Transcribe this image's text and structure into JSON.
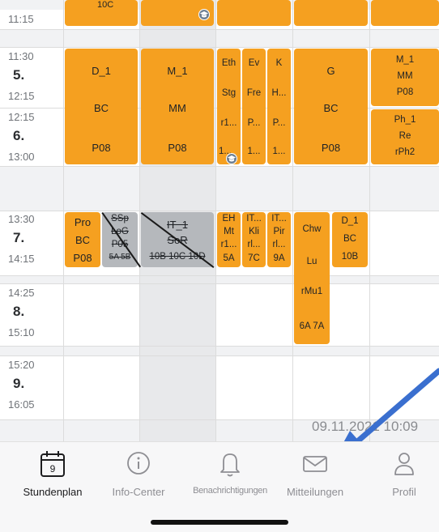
{
  "times": [
    {
      "id": "p4",
      "start": "11:15",
      "end": "",
      "num": ""
    },
    {
      "id": "p5",
      "start": "11:30",
      "end": "12:15",
      "num": "5."
    },
    {
      "id": "p6",
      "start": "12:15",
      "end": "13:00",
      "num": "6."
    },
    {
      "id": "p7",
      "start": "13:30",
      "end": "14:15",
      "num": "7."
    },
    {
      "id": "p8",
      "start": "14:25",
      "end": "15:10",
      "num": "8."
    },
    {
      "id": "p9",
      "start": "15:20",
      "end": "16:05",
      "num": "9."
    }
  ],
  "lessons": {
    "mon56": {
      "l1": "D_1",
      "l2": "BC",
      "l3": "P08"
    },
    "tue56": {
      "l1": "M_1",
      "l2": "MM",
      "l3": "P08"
    },
    "wed56a": {
      "l1": "Eth",
      "l2": "Stg",
      "l3": "r1...",
      "l4": "1..."
    },
    "wed56b": {
      "l1": "Ev",
      "l2": "Fre",
      "l3": "P...",
      "l4": "1..."
    },
    "wed56c": {
      "l1": "K",
      "l2": "H...",
      "l3": "P...",
      "l4": "1..."
    },
    "thu56": {
      "l1": "G",
      "l2": "BC",
      "l3": "P08"
    },
    "fri5": {
      "l1": "M_1",
      "l2": "MM",
      "l3": "P08"
    },
    "fri6": {
      "l1": "Ph_1",
      "l2": "Re",
      "l3": "rPh2"
    },
    "mon7a": {
      "l1": "Pro",
      "l2": "BC",
      "l3": "P08"
    },
    "mon7b": {
      "l1": "SSp",
      "l2": "LoG",
      "l3": "P05",
      "l4": "5A 5B"
    },
    "tue7": {
      "l1": "IT_1",
      "l2": "SoR",
      "l3": "10B 10C 10D"
    },
    "wed7a": {
      "l1": "EH",
      "l2": "Mt",
      "l3": "r1...",
      "l4": "5A"
    },
    "wed7b": {
      "l1": "IT...",
      "l2": "Kli",
      "l3": "rl...",
      "l4": "7C"
    },
    "wed7c": {
      "l1": "IT...",
      "l2": "Pir",
      "l3": "rl...",
      "l4": "9A"
    },
    "thu78": {
      "l1": "Chw",
      "l2": "Lu",
      "l3": "rMu1",
      "l4": "6A 7A"
    },
    "thu7b": {
      "l1": "D_1",
      "l2": "BC",
      "l3": "10B"
    },
    "top_partial": "10C"
  },
  "date_overlay": "09.11.2021 10:09",
  "colors": {
    "lesson": "#f5a020",
    "cancelled": "#b5b8bc",
    "arrow": "#3a6fcf",
    "badge": "#6d7f92"
  },
  "tabbar": {
    "items": [
      {
        "label": "Stundenplan",
        "icon": "calendar-icon",
        "active": true,
        "day": "9"
      },
      {
        "label": "Info-Center",
        "icon": "info-icon",
        "active": false
      },
      {
        "label": "Benachrichtigungen",
        "icon": "bell-icon",
        "active": false
      },
      {
        "label": "Mitteilungen",
        "icon": "mail-icon",
        "active": false
      },
      {
        "label": "Profil",
        "icon": "person-icon",
        "active": false
      }
    ]
  }
}
